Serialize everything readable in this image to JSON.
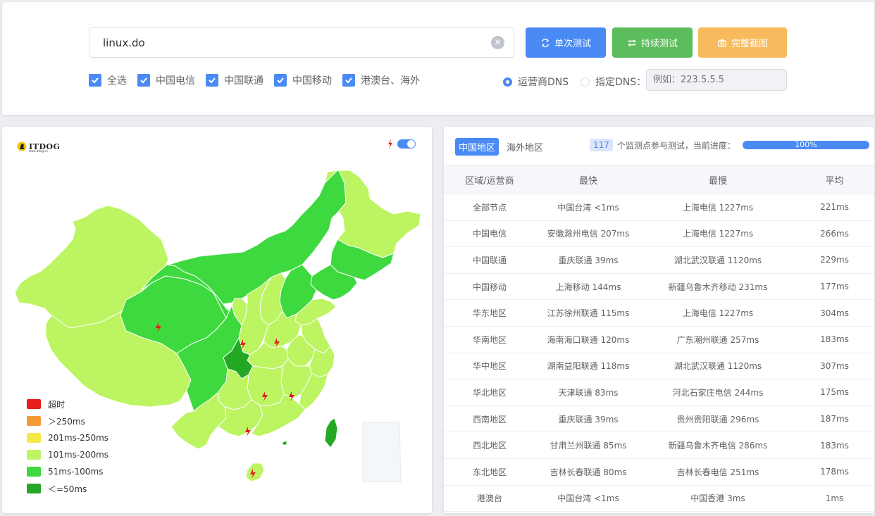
{
  "search": {
    "value": "linux.do",
    "clear_icon": "clear-circle-icon"
  },
  "buttons": {
    "single": "单次测试",
    "continuous": "持续测试",
    "screenshot": "完整截图"
  },
  "colors": {
    "primary": "#4a8af4",
    "success": "#5cbd5c",
    "warning": "#f7bb5d"
  },
  "checkboxes": [
    {
      "label": "全选",
      "checked": true
    },
    {
      "label": "中国电信",
      "checked": true
    },
    {
      "label": "中国联通",
      "checked": true
    },
    {
      "label": "中国移动",
      "checked": true
    },
    {
      "label": "港澳台、海外",
      "checked": true
    }
  ],
  "dns": {
    "isp_label": "运营商DNS",
    "custom_label": "指定DNS：",
    "placeholder": "例如：223.5.5.5",
    "selected": "isp"
  },
  "map": {
    "logo": "ITDOG",
    "logo_sub": "www.itdog.cn",
    "legend": [
      {
        "label": "超时",
        "color": "#e81c1c"
      },
      {
        "label": "＞250ms",
        "color": "#f49b38"
      },
      {
        "label": "201ms-250ms",
        "color": "#f5e94a"
      },
      {
        "label": "101ms-200ms",
        "color": "#bdf461"
      },
      {
        "label": "51ms-100ms",
        "color": "#3ed93e"
      },
      {
        "label": "＜=50ms",
        "color": "#24a824"
      }
    ]
  },
  "results": {
    "tabs": [
      "中国地区",
      "海外地区"
    ],
    "active_tab": 0,
    "count": "117",
    "progress_text": "个监测点参与测试，当前进度：",
    "progress": "100%",
    "progress_value": 1.0,
    "headers": [
      "区域/运营商",
      "最快",
      "最慢",
      "平均"
    ],
    "rows": [
      [
        "全部节点",
        "中国台湾 <1ms",
        "上海电信 1227ms",
        "221ms"
      ],
      [
        "中国电信",
        "安徽滁州电信 207ms",
        "上海电信 1227ms",
        "266ms"
      ],
      [
        "中国联通",
        "重庆联通 39ms",
        "湖北武汉联通 1120ms",
        "229ms"
      ],
      [
        "中国移动",
        "上海移动 144ms",
        "新疆乌鲁木齐移动 231ms",
        "177ms"
      ],
      [
        "华东地区",
        "江苏徐州联通 115ms",
        "上海电信 1227ms",
        "304ms"
      ],
      [
        "华南地区",
        "海南海口联通 120ms",
        "广东潮州联通 257ms",
        "183ms"
      ],
      [
        "华中地区",
        "湖南益阳联通 118ms",
        "湖北武汉联通 1120ms",
        "307ms"
      ],
      [
        "华北地区",
        "天津联通 83ms",
        "河北石家庄电信 244ms",
        "175ms"
      ],
      [
        "西南地区",
        "重庆联通 39ms",
        "贵州贵阳联通 296ms",
        "187ms"
      ],
      [
        "西北地区",
        "甘肃兰州联通 85ms",
        "新疆乌鲁木齐电信 286ms",
        "183ms"
      ],
      [
        "东北地区",
        "吉林长春联通 80ms",
        "吉林长春电信 251ms",
        "178ms"
      ],
      [
        "港澳台",
        "中国台湾 <1ms",
        "中国香港 3ms",
        "1ms"
      ]
    ]
  }
}
